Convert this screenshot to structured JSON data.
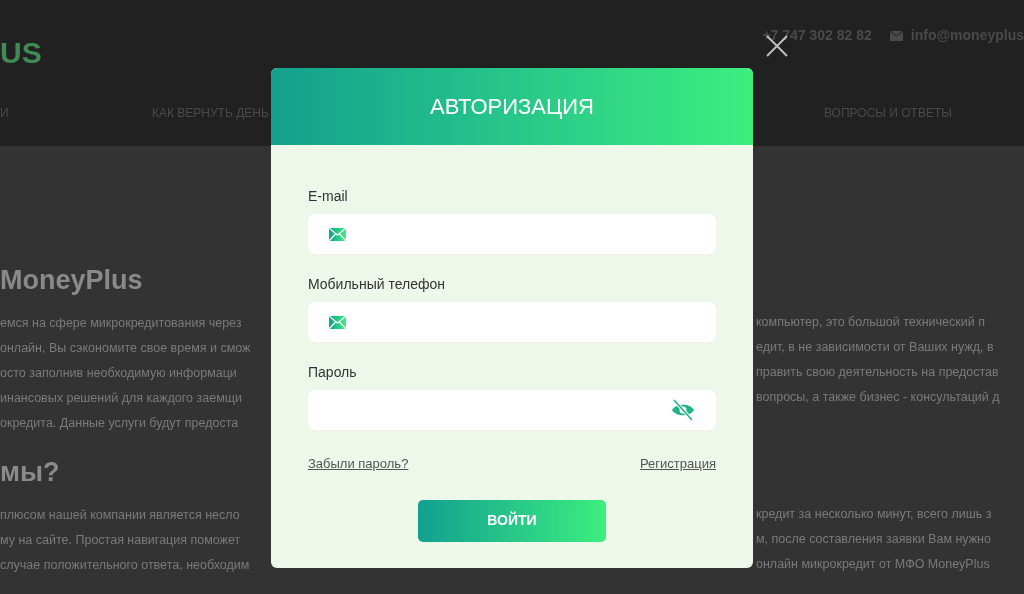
{
  "header": {
    "logo_text": "US",
    "phone": "+7 747 302 82 82",
    "email": "info@moneyplus",
    "nav": [
      "И",
      "КАК ВЕРНУТЬ ДЕНЬ",
      "ВОПРОСЫ И ОТВЕТЫ"
    ]
  },
  "content": {
    "heading_1": "MoneyPlus",
    "paragraph_1": [
      {
        "left": "емся на сфере микрокредитования через",
        "right": "компьютер, это большой технический п"
      },
      {
        "left": "онлайн, Вы сэкономите свое время и смож",
        "right": "едит, в не зависимости от Ваших нужд, в"
      },
      {
        "left": "осто заполнив необходимую информаци",
        "right": "править свою деятельность на предостав"
      },
      {
        "left": "инансовых решений для каждого заемщи",
        "right": "вопросы, а также бизнес - консультаций д"
      },
      {
        "left": "окредита. Данные услуги будут предоста"
      }
    ],
    "heading_2": "мы?",
    "paragraph_2": [
      {
        "left": "плюсом нашей компании является несло",
        "right": "кредит за несколько минут, всего лишь з"
      },
      {
        "left": "му на сайте. Простая навигация поможет",
        "right": "м, после составления заявки Вам нужно"
      },
      {
        "left": "случае положительного ответа, необходим",
        "right": "онлайн микрокредит от МФО MoneyPlus"
      }
    ]
  },
  "modal": {
    "title": "АВТОРИЗАЦИЯ",
    "fields": [
      {
        "kind": "email",
        "label": "E-mail"
      },
      {
        "kind": "phone",
        "label": "Мобильный телефон"
      },
      {
        "kind": "password",
        "label": "Пароль"
      }
    ],
    "forgot_link": "Забыли пароль?",
    "register_link": "Регистрация",
    "submit": "ВОЙТИ"
  }
}
